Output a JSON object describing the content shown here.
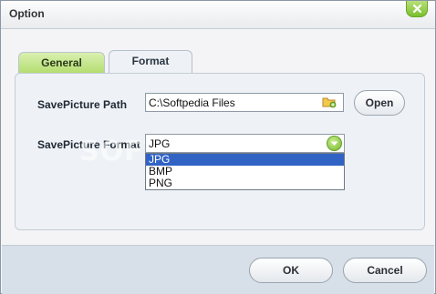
{
  "window": {
    "title": "Option"
  },
  "tabs": [
    {
      "label": "General"
    },
    {
      "label": "Format"
    }
  ],
  "save_path": {
    "label": "SavePicture Path",
    "value": "C:\\Softpedia Files",
    "open_label": "Open"
  },
  "save_format": {
    "label": "SavePicture Format",
    "selected": "JPG",
    "options": [
      "JPG",
      "BMP",
      "PNG"
    ],
    "highlighted_option": "JPG"
  },
  "watermark": "SOFTPEDIA",
  "buttons": {
    "ok": "OK",
    "cancel": "Cancel"
  },
  "icons": {
    "close": "close-icon",
    "folder": "folder-icon",
    "dropdown": "chevron-down-icon"
  },
  "colors": {
    "accent_green": "#8cc63f",
    "selection_blue": "#3163c5",
    "footer_bg": "#d7dfe9"
  }
}
